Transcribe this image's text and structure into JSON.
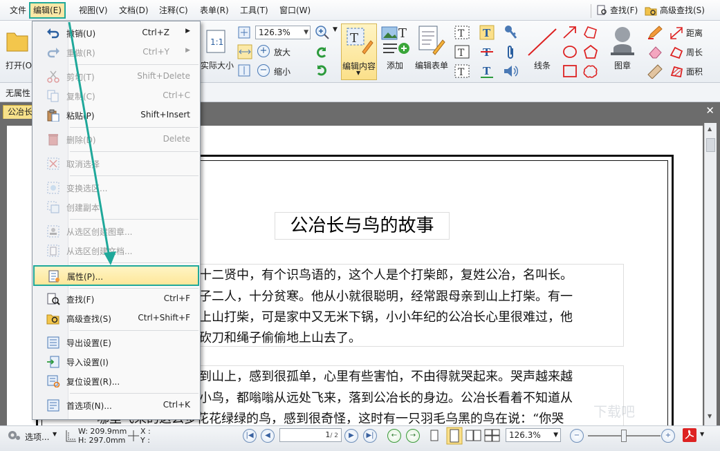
{
  "menubar": {
    "items": [
      "文件",
      "编辑(E)",
      "视图(V)",
      "文档(D)",
      "注释(C)",
      "表单(R)",
      "工具(T)",
      "窗口(W)"
    ],
    "find": "查找(F)",
    "advanced_find": "高级查找(S)"
  },
  "ribbon": {
    "open": "打开(O)",
    "actual_size": "实际大小",
    "zoom_value": "126.3%",
    "zoom_in": "放大",
    "zoom_out": "缩小",
    "edit_content": "编辑内容",
    "add": "添加",
    "edit_form": "编辑表单",
    "line": "线条",
    "stamp": "图章",
    "distance": "距离",
    "perimeter": "周长",
    "area": "面积"
  },
  "propbar": {
    "no_props": "无属性"
  },
  "tab": {
    "name": "公冶长"
  },
  "document": {
    "title": "公冶长与鸟的故事",
    "para1": [
      "十二贤中，有个识鸟语的，这个人是个打柴郎，复姓公冶，名叫长。",
      "子二人，十分贫寒。他从小就很聪明，经常跟母亲到山上打柴。有一",
      "上山打柴，可是家中又无米下锅，小小年纪的公冶长心里很难过，他",
      "砍刀和绳子偷偷地上山去了。"
    ],
    "para2": [
      "到山上，感到很孤单，心里有些害怕，不由得就哭起来。哭声越来越",
      "小鸟，都嗡嗡从远处飞来，落到公冶长的身边。公冶长看着不知道从",
      "哪里飞来的这么多花花绿绿的鸟，感到很奇怪，这时有一只羽毛乌黑的鸟在说：“你哭"
    ]
  },
  "edit_menu": [
    {
      "label": "撤销(U)",
      "shortcut": "Ctrl+Z",
      "submenu": true,
      "disabled": false,
      "icon": "undo-icon"
    },
    {
      "label": "重做(R)",
      "shortcut": "Ctrl+Y",
      "submenu": true,
      "disabled": true,
      "icon": "redo-icon"
    },
    {
      "label": "剪切(T)",
      "shortcut": "Shift+Delete",
      "disabled": true,
      "icon": "cut-icon"
    },
    {
      "label": "复制(C)",
      "shortcut": "Ctrl+C",
      "disabled": true,
      "icon": "copy-icon"
    },
    {
      "label": "粘贴(P)",
      "shortcut": "Shift+Insert",
      "disabled": false,
      "icon": "paste-icon"
    },
    {
      "label": "删除(D)",
      "shortcut": "Delete",
      "disabled": true,
      "icon": "delete-icon"
    },
    {
      "label": "取消选择",
      "shortcut": "",
      "disabled": true,
      "icon": "deselect-icon"
    },
    {
      "label": "变换选区...",
      "shortcut": "",
      "disabled": true,
      "icon": "transform-icon"
    },
    {
      "label": "创建副本",
      "shortcut": "",
      "disabled": true,
      "icon": "duplicate-icon"
    },
    {
      "label": "从选区创建图章...",
      "shortcut": "",
      "disabled": true,
      "icon": "stamp-from-selection-icon"
    },
    {
      "label": "从选区创建文档...",
      "shortcut": "",
      "disabled": true,
      "icon": "doc-from-selection-icon"
    },
    {
      "label": "属性(P)...",
      "shortcut": "",
      "disabled": false,
      "icon": "properties-icon"
    },
    {
      "label": "查找(F)",
      "shortcut": "Ctrl+F",
      "disabled": false,
      "icon": "find-icon"
    },
    {
      "label": "高级查找(S)",
      "shortcut": "Ctrl+Shift+F",
      "disabled": false,
      "icon": "advanced-find-icon"
    },
    {
      "label": "导出设置(E)",
      "shortcut": "",
      "disabled": false,
      "icon": "export-settings-icon"
    },
    {
      "label": "导入设置(I)",
      "shortcut": "",
      "disabled": false,
      "icon": "import-settings-icon"
    },
    {
      "label": "复位设置(R)...",
      "shortcut": "",
      "disabled": false,
      "icon": "reset-settings-icon"
    },
    {
      "label": "首选项(N)...",
      "shortcut": "Ctrl+K",
      "disabled": false,
      "icon": "preferences-icon"
    }
  ],
  "status": {
    "select": "选项...",
    "width": "W: 209.9mm",
    "height": "H: 297.0mm",
    "x": "X :",
    "y": "Y :",
    "page": "1",
    "page_total": "/ 2",
    "zoom": "126.3%"
  },
  "watermark": "下载吧",
  "colors": {
    "highlight_border": "#1fa89a",
    "menu_hover": "#fde79a",
    "tab": "#f7e18a"
  }
}
